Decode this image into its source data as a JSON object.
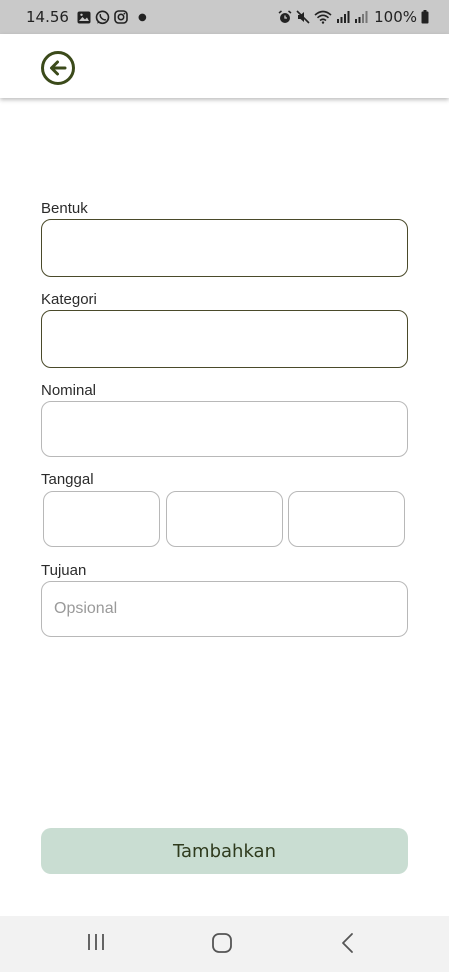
{
  "status_bar": {
    "time": "14.56",
    "battery": "100%",
    "left_icons": [
      "gallery-icon",
      "whatsapp-icon",
      "instagram-icon",
      "notification-dot-icon"
    ],
    "right_icons": [
      "alarm-icon",
      "mute-icon",
      "wifi-icon",
      "signal-icon",
      "signal-icon",
      "battery-icon"
    ]
  },
  "app_bar": {
    "back_icon": "arrow-left-circle-icon",
    "accent": "#3b4a1a"
  },
  "form": {
    "bentuk": {
      "label": "Bentuk",
      "value": ""
    },
    "kategori": {
      "label": "Kategori",
      "value": ""
    },
    "nominal": {
      "label": "Nominal",
      "value": ""
    },
    "tanggal": {
      "label": "Tanggal",
      "day": "",
      "month": "",
      "year": ""
    },
    "tujuan": {
      "label": "Tujuan",
      "placeholder": "Opsional",
      "value": ""
    },
    "submit_label": "Tambahkan",
    "submit_color": "#c9ddd2"
  },
  "nav_bar": {
    "icons": [
      "recent-apps-icon",
      "home-icon",
      "back-icon"
    ]
  }
}
